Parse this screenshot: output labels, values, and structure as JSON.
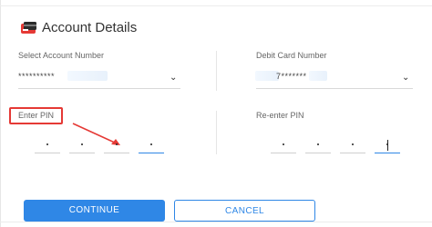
{
  "header": {
    "title": "Account Details",
    "icon": "card-wallet-icon"
  },
  "account": {
    "label": "Select Account Number",
    "value": "**********"
  },
  "debit": {
    "label": "Debit Card Number",
    "value_prefix": "···",
    "value": "7*******"
  },
  "pin": {
    "label": "Enter PIN",
    "dot": "•"
  },
  "repin": {
    "label": "Re-enter PIN",
    "dot": "•"
  },
  "buttons": {
    "continue": "CONTINUE",
    "cancel": "CANCEL"
  },
  "colors": {
    "accent": "#2f87e6",
    "annotation": "#e53935"
  }
}
